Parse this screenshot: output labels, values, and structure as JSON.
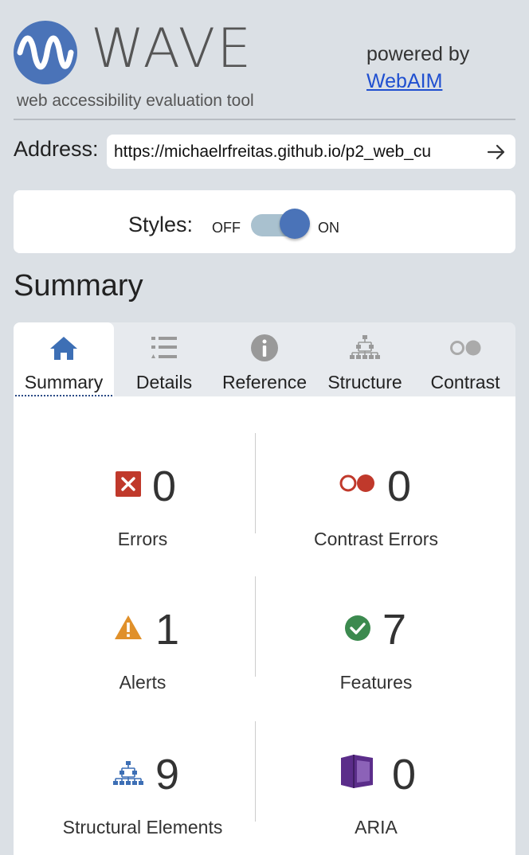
{
  "header": {
    "logo_text": "WAVE",
    "tagline": "web accessibility evaluation tool",
    "powered_by": "powered by",
    "webaim_link": "WebAIM",
    "brand_color": "#4a73b8"
  },
  "address": {
    "label": "Address:",
    "value": "https://michaelrfreitas.github.io/p2_web_cu",
    "go_icon": "arrow-right-icon"
  },
  "styles": {
    "label": "Styles:",
    "off_label": "OFF",
    "on_label": "ON",
    "state": "on"
  },
  "summary_heading": "Summary",
  "tabs": [
    {
      "label": "Summary",
      "icon": "home-icon",
      "active": true
    },
    {
      "label": "Details",
      "icon": "list-icon",
      "active": false
    },
    {
      "label": "Reference",
      "icon": "info-icon",
      "active": false
    },
    {
      "label": "Structure",
      "icon": "hierarchy-icon",
      "active": false
    },
    {
      "label": "Contrast",
      "icon": "contrast-icon",
      "active": false
    }
  ],
  "stats": {
    "errors": {
      "count": "0",
      "label": "Errors",
      "color": "#c0392b"
    },
    "contrast_errors": {
      "count": "0",
      "label": "Contrast Errors",
      "color": "#c0392b"
    },
    "alerts": {
      "count": "1",
      "label": "Alerts",
      "color": "#e0902a"
    },
    "features": {
      "count": "7",
      "label": "Features",
      "color": "#3c8a4f"
    },
    "structural": {
      "count": "9",
      "label": "Structural Elements",
      "color": "#3d6fb5"
    },
    "aria": {
      "count": "0",
      "label": "ARIA",
      "color": "#5b2d8a"
    }
  }
}
